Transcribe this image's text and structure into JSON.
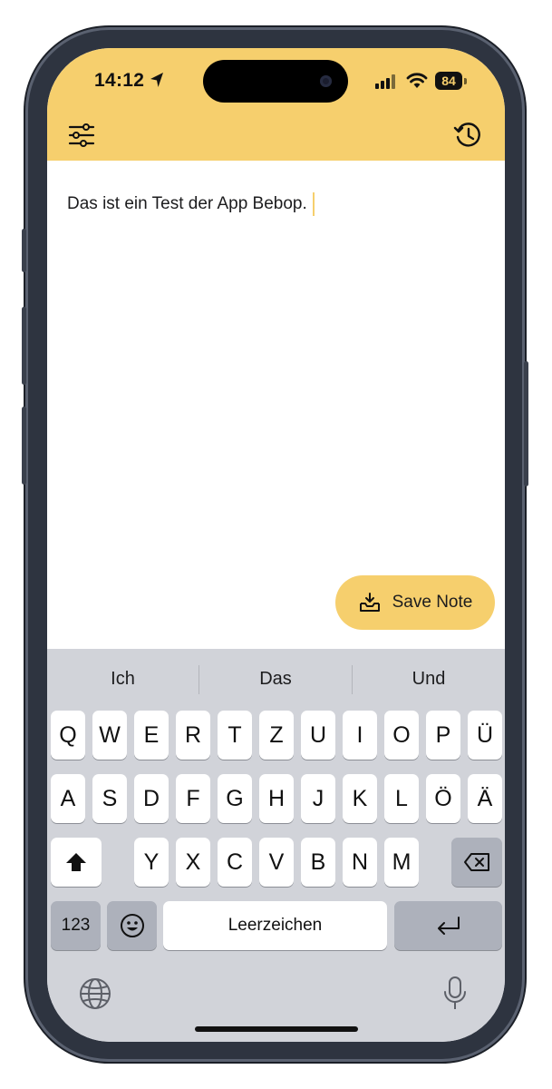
{
  "status_bar": {
    "time": "14:12",
    "battery": "84",
    "icons": [
      "location-arrow-icon",
      "cellular-signal-icon",
      "wifi-icon",
      "battery-icon"
    ]
  },
  "header": {
    "left_icon": "filter-sliders-icon",
    "right_icon": "history-clock-icon",
    "accent_color": "#f6cf6d"
  },
  "editor": {
    "text": "Das ist ein Test der App Bebop."
  },
  "save_button": {
    "label": "Save Note",
    "icon": "inbox-download-icon"
  },
  "keyboard": {
    "suggestions": [
      "Ich",
      "Das",
      "Und"
    ],
    "row1": [
      "Q",
      "W",
      "E",
      "R",
      "T",
      "Z",
      "U",
      "I",
      "O",
      "P",
      "Ü"
    ],
    "row2": [
      "A",
      "S",
      "D",
      "F",
      "G",
      "H",
      "J",
      "K",
      "L",
      "Ö",
      "Ä"
    ],
    "row3": [
      "Y",
      "X",
      "C",
      "V",
      "B",
      "N",
      "M"
    ],
    "numbers_key": "123",
    "space_key": "Leerzeichen",
    "icons": [
      "shift-icon",
      "backspace-icon",
      "emoji-icon",
      "return-icon",
      "globe-icon",
      "microphone-icon"
    ]
  }
}
